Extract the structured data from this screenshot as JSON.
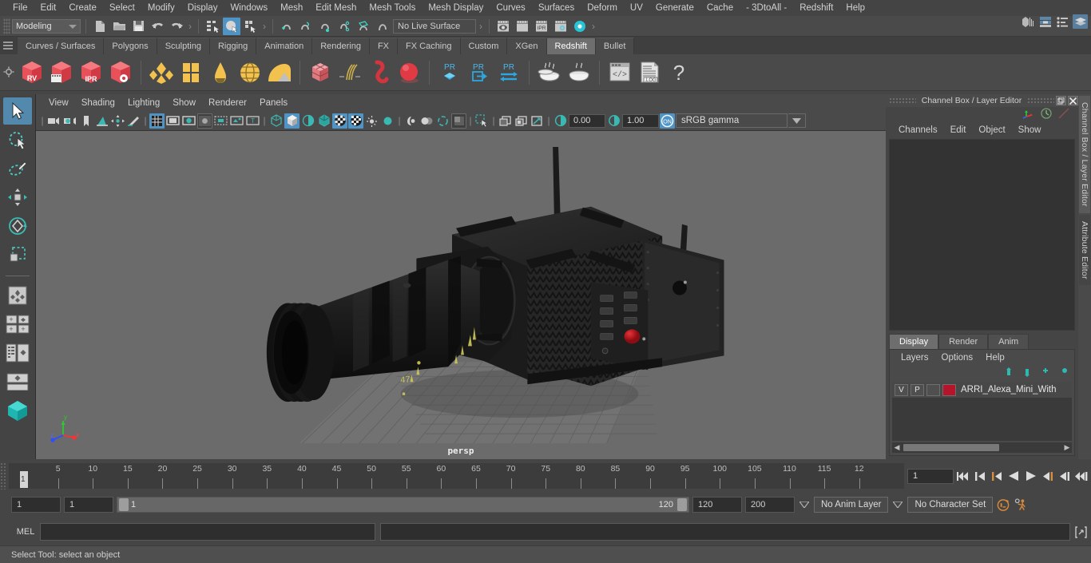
{
  "menubar": {
    "items": [
      "File",
      "Edit",
      "Create",
      "Select",
      "Modify",
      "Display",
      "Windows",
      "Mesh",
      "Edit Mesh",
      "Mesh Tools",
      "Mesh Display",
      "Curves",
      "Surfaces",
      "Deform",
      "UV",
      "Generate",
      "Cache",
      "- 3DtoAll -",
      "Redshift",
      "Help"
    ]
  },
  "top_right_icons": [
    "modeling-toolkit-icon",
    "attribute-editor-icon",
    "tool-settings-icon",
    "channel-box-icon"
  ],
  "statusline": {
    "mode": "Modeling",
    "file_icons": [
      "new-scene-icon",
      "open-scene-icon",
      "save-scene-icon",
      "undo-icon",
      "redo-icon"
    ],
    "selection_mask_icons": [
      "select-by-hierarchy-icon",
      "select-by-object-type-icon",
      "select-by-component-type-icon"
    ],
    "snap_icons": [
      "snap-to-grid-icon",
      "snap-to-curve-icon",
      "snap-to-point-icon",
      "snap-to-projected-center-icon",
      "snap-to-view-plane-icon",
      "make-live-icon"
    ],
    "live_surface": "No Live Surface",
    "render_icons": [
      "render-current-frame-icon",
      "render-sequence-icon",
      "ipr-render-icon",
      "render-settings-icon",
      "hypershade-icon"
    ]
  },
  "shelf": {
    "tabs": [
      "Curves / Surfaces",
      "Polygons",
      "Sculpting",
      "Rigging",
      "Animation",
      "Rendering",
      "FX",
      "FX Caching",
      "Custom",
      "XGen",
      "Redshift",
      "Bullet"
    ],
    "active_tab": "Redshift",
    "icons": [
      {
        "name": "redshift-render-view-icon",
        "label": "RV"
      },
      {
        "name": "redshift-render-sequence-icon",
        "label": ""
      },
      {
        "name": "redshift-ipr-icon",
        "label": "IPR"
      },
      {
        "name": "redshift-render-settings-icon",
        "label": ""
      },
      {
        "name": "redshift-material-icon",
        "label": ""
      },
      {
        "name": "redshift-material-blender-icon",
        "label": ""
      },
      {
        "name": "redshift-incandescent-icon",
        "label": ""
      },
      {
        "name": "redshift-dome-light-icon",
        "label": ""
      },
      {
        "name": "redshift-environment-icon",
        "label": ""
      },
      {
        "name": "redshift-proxy-icon",
        "label": ""
      },
      {
        "name": "redshift-hair-icon",
        "label": ""
      },
      {
        "name": "redshift-volume-icon",
        "label": ""
      },
      {
        "name": "redshift-sphere-icon",
        "label": ""
      },
      {
        "name": "redshift-proxy-create-icon",
        "label": "PR"
      },
      {
        "name": "redshift-proxy-export-icon",
        "label": "PR"
      },
      {
        "name": "redshift-proxy-convert-icon",
        "label": "PR"
      },
      {
        "name": "redshift-bake-icon",
        "label": ""
      },
      {
        "name": "redshift-bake-all-icon",
        "label": ""
      },
      {
        "name": "redshift-script-editor-icon",
        "label": ""
      },
      {
        "name": "redshift-log-icon",
        "label": ".LOG"
      },
      {
        "name": "redshift-help-icon",
        "label": "?"
      }
    ]
  },
  "lefttoolbar": {
    "items": [
      {
        "name": "select-tool",
        "selected": true
      },
      {
        "name": "lasso-select-tool",
        "selected": false
      },
      {
        "name": "paint-select-tool",
        "selected": false
      },
      {
        "name": "move-tool",
        "selected": false
      },
      {
        "name": "rotate-tool",
        "selected": false
      },
      {
        "name": "scale-tool",
        "selected": false
      },
      {
        "name": "last-tool-used",
        "selected": false
      },
      {
        "name": "quad-view-layout",
        "selected": false
      },
      {
        "name": "outliner-persp-layout",
        "selected": false
      },
      {
        "name": "persp-graph-layout",
        "selected": false
      },
      {
        "name": "hypershade-layout",
        "selected": false
      }
    ]
  },
  "viewport": {
    "menus": [
      "View",
      "Shading",
      "Lighting",
      "Show",
      "Renderer",
      "Panels"
    ],
    "camera_label": "persp",
    "toolbar_icons": [
      "select-camera-icon",
      "camera-attributes-icon",
      "bookmarks-icon",
      "image-plane-icon",
      "two-d-pan-zoom-icon",
      "grease-pencil-icon",
      "grid-toggle-icon",
      "film-gate-icon",
      "resolution-gate-icon",
      "gate-mask-icon",
      "field-chart-icon",
      "safe-action-icon",
      "safe-title-icon",
      "wireframe-icon",
      "smooth-shade-all-icon",
      "smooth-shade-selected-icon",
      "flat-shade-icon",
      "wireframe-on-shaded-icon",
      "xray-icon",
      "xray-joints-icon",
      "xray-active-components-icon",
      "lights-toggle-icon",
      "shadows-icon",
      "screenspace-ao-icon",
      "motion-blur-icon",
      "multisample-icon",
      "depth-peeling-icon",
      "isolate-select-icon",
      "texture-toggle-icon",
      "display-layer-icon",
      "display-all-icon"
    ],
    "exposure_value": "0.00",
    "gamma_value": "1.00",
    "color_management": "sRGB gamma",
    "axis_labels": {
      "x": "x",
      "y": "y",
      "z": "z"
    }
  },
  "rightdock": {
    "title": "Channel Box / Layer Editor",
    "window_buttons": [
      "restore-icon",
      "close-icon"
    ],
    "top_icons": [
      "channel-box-axis-icon",
      "channel-box-speed-icon",
      "channel-box-slope-icon"
    ],
    "menus": [
      "Channels",
      "Edit",
      "Object",
      "Show"
    ],
    "layer_tabs": [
      "Display",
      "Render",
      "Anim"
    ],
    "active_layer_tab": "Display",
    "layer_menus": [
      "Layers",
      "Options",
      "Help"
    ],
    "layer_arrow_icons": [
      "move-layer-up-icon",
      "move-layer-down-icon",
      "new-layer-icon",
      "new-layer-from-selected-icon"
    ],
    "layers": [
      {
        "visibility": "V",
        "playback": "P",
        "type": "",
        "color": "#b5142b",
        "name": "ARRI_Alexa_Mini_With"
      }
    ],
    "side_tabs": [
      "Channel Box / Layer Editor",
      "Attribute Editor"
    ]
  },
  "timeline": {
    "labels": [
      "5",
      "10",
      "15",
      "20",
      "25",
      "30",
      "35",
      "40",
      "45",
      "50",
      "55",
      "60",
      "65",
      "70",
      "75",
      "80",
      "85",
      "90",
      "95",
      "100",
      "105",
      "110",
      "115",
      "12"
    ],
    "current_frame_marker": "1",
    "current_frame_field": "1",
    "playback_icons": [
      "go-to-start-icon",
      "step-back-key-icon",
      "step-back-frame-icon",
      "play-backwards-icon",
      "play-forwards-icon",
      "step-forward-frame-icon",
      "step-forward-key-icon",
      "go-to-end-icon"
    ]
  },
  "rangeslider": {
    "anim_start": "1",
    "range_start": "1",
    "range_bar_min": "1",
    "range_bar_max": "120",
    "range_end": "120",
    "anim_end": "200",
    "anim_layer": "No Anim Layer",
    "character_set": "No Character Set",
    "right_icons": [
      "auto-key-icon",
      "animation-preferences-icon"
    ]
  },
  "commandline": {
    "language_label": "MEL",
    "input_value": "",
    "output_value": "",
    "script_editor_icon": "script-editor-icon"
  },
  "helpline": {
    "message": "Select Tool: select an object"
  }
}
